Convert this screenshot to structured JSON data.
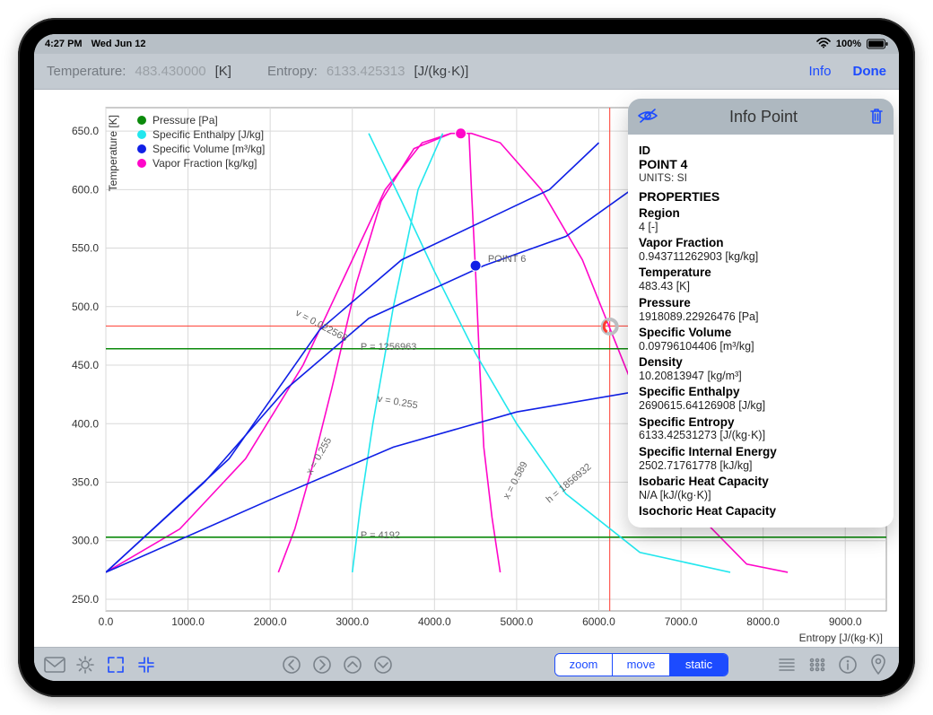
{
  "status": {
    "time": "4:27 PM",
    "date": "Wed Jun 12",
    "wifi": "wifi-icon",
    "battery_pct": "100%"
  },
  "topbar": {
    "temp_label": "Temperature:",
    "temp_value": "483.430000",
    "temp_unit": "[K]",
    "entropy_label": "Entropy:",
    "entropy_value": "6133.425313",
    "entropy_unit": "[J/(kg·K)]",
    "info": "Info",
    "done": "Done"
  },
  "legend": {
    "axis": "Temperature [K]",
    "items": [
      {
        "color": "#0b8a0b",
        "label": "Pressure [Pa]"
      },
      {
        "color": "#22e7ee",
        "label": "Specific Enthalpy [J/kg]"
      },
      {
        "color": "#1020e6",
        "label": "Specific Volume [m³/kg]"
      },
      {
        "color": "#ff06c9",
        "label": "Vapor Fraction [kg/kg]"
      }
    ]
  },
  "chart_data": {
    "type": "line",
    "title": "",
    "xlabel": "Entropy [J/(kg·K)]",
    "ylabel": "Temperature [K]",
    "xlim": [
      0,
      9500
    ],
    "ylim": [
      240,
      670
    ],
    "xticks": [
      0,
      1000,
      2000,
      3000,
      4000,
      5000,
      6000,
      7000,
      8000,
      9000
    ],
    "yticks": [
      250,
      300,
      350,
      400,
      450,
      500,
      550,
      600,
      650
    ],
    "annotations": [
      {
        "text": "v = 0.022568",
        "x": 2300,
        "y": 493,
        "rotate": 28
      },
      {
        "text": "P = 1256963",
        "x": 3100,
        "y": 463
      },
      {
        "text": "v = 0.255",
        "x": 3300,
        "y": 419,
        "rotate": 10
      },
      {
        "text": "x = 0.255",
        "x": 2500,
        "y": 356,
        "rotate": -60
      },
      {
        "text": "P = 4192",
        "x": 3100,
        "y": 302
      },
      {
        "text": "x = 0.589",
        "x": 4900,
        "y": 335,
        "rotate": -62
      },
      {
        "text": "h = 1856932",
        "x": 5400,
        "y": 332,
        "rotate": -40
      },
      {
        "text": "POINT 6",
        "x": 4650,
        "y": 538
      }
    ],
    "crosshair": {
      "x": 6133.425313,
      "y": 483.43,
      "color": "#ff3b30"
    },
    "series": [
      {
        "name": "saturation-dome",
        "color": "#ff06c9",
        "points": [
          [
            0,
            273
          ],
          [
            900,
            310
          ],
          [
            1700,
            370
          ],
          [
            2400,
            450
          ],
          [
            3000,
            540
          ],
          [
            3400,
            600
          ],
          [
            3850,
            640
          ],
          [
            4200,
            648
          ],
          [
            4450,
            648
          ],
          [
            4800,
            640
          ],
          [
            5300,
            600
          ],
          [
            5800,
            540
          ],
          [
            6200,
            470
          ],
          [
            6600,
            400
          ],
          [
            7100,
            330
          ],
          [
            7800,
            280
          ],
          [
            8300,
            273
          ]
        ]
      },
      {
        "name": "x=0.255",
        "color": "#ff06c9",
        "points": [
          [
            2100,
            273
          ],
          [
            2300,
            310
          ],
          [
            2500,
            360
          ],
          [
            2750,
            430
          ],
          [
            3050,
            520
          ],
          [
            3350,
            590
          ],
          [
            3750,
            635
          ],
          [
            4200,
            648
          ]
        ]
      },
      {
        "name": "x=0.589",
        "color": "#ff06c9",
        "points": [
          [
            4800,
            273
          ],
          [
            4700,
            320
          ],
          [
            4600,
            380
          ],
          [
            4550,
            450
          ],
          [
            4500,
            530
          ],
          [
            4450,
            600
          ],
          [
            4420,
            648
          ]
        ]
      },
      {
        "name": "P=1256963",
        "color": "#0b8a0b",
        "points": [
          [
            0,
            464
          ],
          [
            9500,
            464
          ]
        ]
      },
      {
        "name": "P=4192",
        "color": "#0b8a0b",
        "points": [
          [
            0,
            303
          ],
          [
            9500,
            303
          ]
        ]
      },
      {
        "name": "h=1856932",
        "color": "#22e7ee",
        "points": [
          [
            3200,
            648
          ],
          [
            3600,
            590
          ],
          [
            4000,
            530
          ],
          [
            4500,
            460
          ],
          [
            5000,
            400
          ],
          [
            5600,
            340
          ],
          [
            6500,
            290
          ],
          [
            7600,
            273
          ]
        ]
      },
      {
        "name": "h-upper",
        "color": "#22e7ee",
        "points": [
          [
            3000,
            273
          ],
          [
            3100,
            330
          ],
          [
            3250,
            400
          ],
          [
            3500,
            500
          ],
          [
            3800,
            600
          ],
          [
            4100,
            648
          ]
        ]
      },
      {
        "name": "v=0.022568",
        "color": "#1020e6",
        "points": [
          [
            0,
            273
          ],
          [
            1500,
            370
          ],
          [
            2600,
            480
          ],
          [
            3600,
            540
          ],
          [
            4650,
            575
          ],
          [
            5400,
            600
          ],
          [
            6000,
            640
          ]
        ]
      },
      {
        "name": "v=0.255",
        "color": "#1020e6",
        "points": [
          [
            0,
            273
          ],
          [
            2000,
            335
          ],
          [
            3500,
            380
          ],
          [
            5000,
            410
          ],
          [
            6500,
            428
          ],
          [
            8000,
            440
          ],
          [
            9500,
            448
          ]
        ]
      },
      {
        "name": "v-mid",
        "color": "#1020e6",
        "points": [
          [
            0,
            273
          ],
          [
            1200,
            350
          ],
          [
            2200,
            430
          ],
          [
            3200,
            490
          ],
          [
            4600,
            535
          ],
          [
            5600,
            560
          ],
          [
            6400,
            600
          ],
          [
            6800,
            648
          ]
        ]
      }
    ],
    "markers": [
      {
        "name": "POINT 6",
        "x": 4500,
        "y": 535,
        "color": "#1020e6"
      },
      {
        "name": "dome-top",
        "x": 4320,
        "y": 648,
        "color": "#ff06c9"
      },
      {
        "name": "POINT 4",
        "x": 6133,
        "y": 483,
        "color": "#ff3b30",
        "ring": true
      }
    ]
  },
  "info_panel": {
    "title": "Info Point",
    "id_heading": "ID",
    "point_id": "POINT 4",
    "units": "UNITS: SI",
    "props_heading": "PROPERTIES",
    "properties": [
      {
        "k": "Region",
        "v": "4 [-]"
      },
      {
        "k": "Vapor Fraction",
        "v": "0.943711262903 [kg/kg]"
      },
      {
        "k": "Temperature",
        "v": "483.43 [K]"
      },
      {
        "k": "Pressure",
        "v": "1918089.22926476 [Pa]"
      },
      {
        "k": "Specific Volume",
        "v": "0.09796104406 [m³/kg]"
      },
      {
        "k": "Density",
        "v": "10.20813947 [kg/m³]"
      },
      {
        "k": "Specific Enthalpy",
        "v": "2690615.64126908 [J/kg]"
      },
      {
        "k": "Specific Entropy",
        "v": "6133.42531273 [J/(kg·K)]"
      },
      {
        "k": "Specific Internal Energy",
        "v": "2502.71761778 [kJ/kg]"
      },
      {
        "k": "Isobaric Heat Capacity",
        "v": "N/A [kJ/(kg·K)]"
      },
      {
        "k": "Isochoric Heat Capacity",
        "v": ""
      }
    ]
  },
  "bottombar": {
    "segments": [
      "zoom",
      "move",
      "static"
    ],
    "active_segment": 2
  }
}
